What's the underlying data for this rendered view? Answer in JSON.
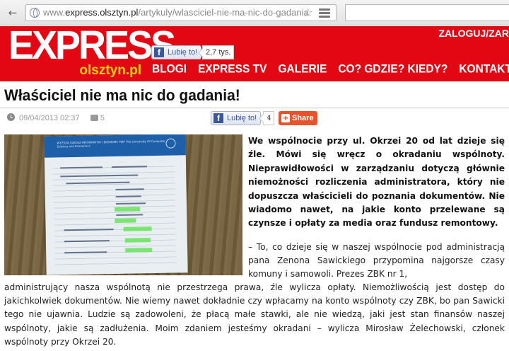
{
  "browser": {
    "url_prefix": "www.",
    "url_domain": "express.olsztyn.pl",
    "url_path": "/artykuly/wlasciciel-nie-ma-nic-do-gadania"
  },
  "header": {
    "logo_main": "EXPRESS",
    "logo_sub": "olsztyn.pl",
    "login_link": "ZALOGUJ/ZAR",
    "fb_like_label": "Lubię to!",
    "fb_like_count": "2,7 tys.",
    "nav": [
      "BLOGI",
      "EXPRESS TV",
      "GALERIE",
      "CO? GDZIE? KIEDY?",
      "KONTAKT"
    ]
  },
  "article": {
    "title": "Właściciel nie ma nic do gadania!",
    "date": "09/04/2013 02:37",
    "comment_count": "5",
    "like_label": "Lubię to!",
    "like_count": "4",
    "share_label": "Share",
    "photo_header_text": "WYŻSZA SZKOŁA INFORMATYKI I EKONOMII TWP The University Of Computer Science and Economics",
    "lead": "We wspólnocie przy ul. Okrzei 20 od lat dzieje się źle. Mówi się wręcz o okradaniu wspólnoty. Nieprawidłowości w zarządzaniu dotyczą głównie niemożności rozliczenia administratora, który nie dopuszcza właścicieli do poznania dokumentów. Nie wiadomo nawet, na jakie konto przelewane są czynsze i opłaty za media oraz fundusz remontowy.",
    "body_right": "– To, co dzieje się w naszej wspólnocie pod administracją pana Zenona Sawickiego przypomina najgorsze czasy komuny i samowoli. Prezes ZBK nr 1,",
    "body_full": "administrujący nasza wspólnotą nie przestrzega prawa, źle wylicza opłaty. Niemożliwością jest dostęp do jakichkolwiek dokumentów. Nie wiemy nawet dokładnie czy wpłacamy na konto wspólnoty czy ZBK, bo pan Sawicki tego nie ujawnia. Ludzie są zadowoleni, że płacą małe stawki, ale nie wiedzą, jaki jest stan finansów naszej wspólnoty, jakie są zadłużenia. Moim zdaniem jesteśmy okradani – wylicza Mirosław Żelechowski, członek wspólnoty przy Okrzei 20."
  },
  "colors": {
    "brand_red": "#e30613",
    "logo_yellow": "#ffd200",
    "share_orange": "#e8522d",
    "facebook_blue": "#3b5998"
  }
}
